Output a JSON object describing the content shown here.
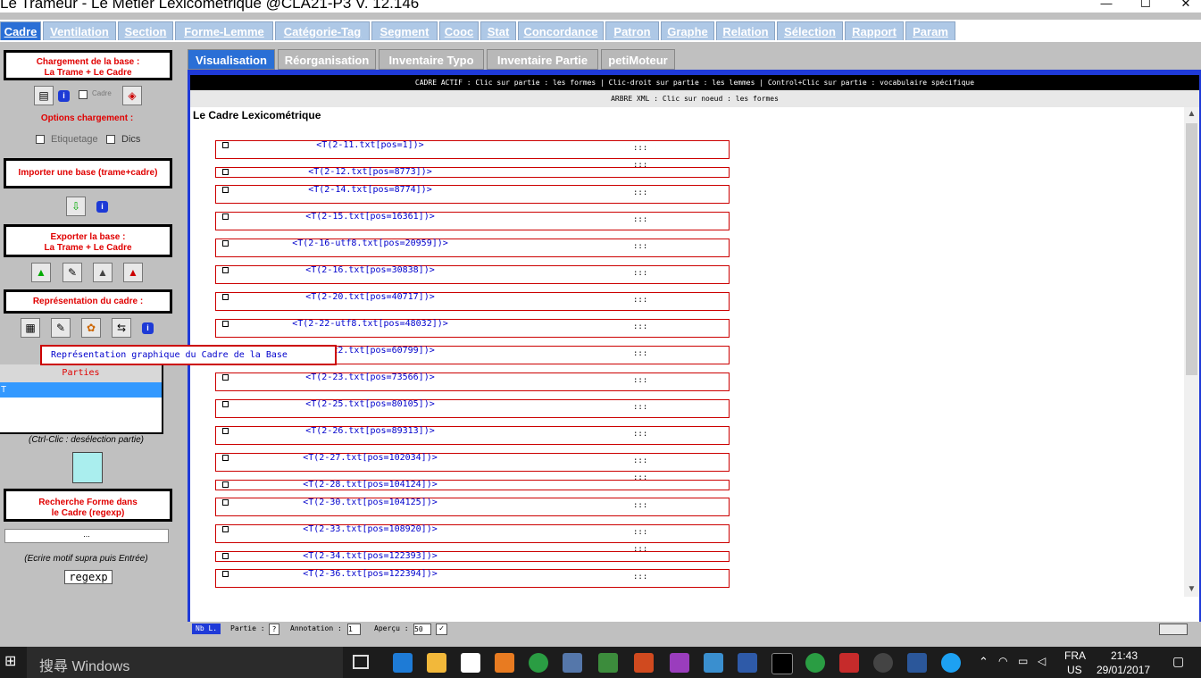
{
  "window": {
    "title": "Le Trameur - Le Métier Lexicométrique @CLA21-P3 V. 12.146",
    "min": "—",
    "max": "☐",
    "close": "✕"
  },
  "main_tabs": [
    "Cadre",
    "Ventilation",
    "Section",
    "Forme-Lemme",
    "Catégorie-Tag",
    "Segment",
    "Cooc",
    "Stat",
    "Concordance",
    "Patron",
    "Graphe",
    "Relation",
    "Sélection",
    "Rapport",
    "Param"
  ],
  "left": {
    "load_box": "Chargement de la base :\nLa Trame + Le Cadre",
    "cadre_label": "Cadre",
    "options_label": "Options chargement :",
    "etiquetage_label": "Etiquetage",
    "dics_label": "Dics",
    "import_box": "Importer une base (trame+cadre)",
    "export_box": "Exporter la base :\nLa Trame + Le Cadre",
    "repr_box": "Représentation du cadre :",
    "parties_header": "Parties",
    "parties_selected": "T",
    "deselect_hint": "(Ctrl-Clic : desélection partie)",
    "search_box": "Recherche Forme dans\nle Cadre (regexp)",
    "search_value": "...",
    "search_hint": "(Ecrire motif supra puis Entrée)",
    "regexp_button": "regexp",
    "info": "i"
  },
  "sub_tabs": [
    "Visualisation",
    "Réorganisation",
    "Inventaire Typo",
    "Inventaire Partie",
    "petiMoteur"
  ],
  "active_bar": "CADRE ACTIF : Clic sur partie : les formes | Clic-droit sur partie : les lemmes | Control+Clic sur partie : vocabulaire spécifique",
  "xml_bar": "ARBRE XML : Clic sur noeud : les formes",
  "content_title": "Le Cadre Lexicométrique",
  "nodes": [
    {
      "label": "<T(2-11.txt[pos=1])>",
      "dots": ":::"
    },
    {
      "label": "<T(2-12.txt[pos=8773])>",
      "dots": ":::"
    },
    {
      "label": "<T(2-14.txt[pos=8774])>",
      "dots": ":::"
    },
    {
      "label": "<T(2-15.txt[pos=16361])>",
      "dots": ":::"
    },
    {
      "label": "<T(2-16-utf8.txt[pos=20959])>",
      "dots": ":::"
    },
    {
      "label": "<T(2-16.txt[pos=30838])>",
      "dots": ":::"
    },
    {
      "label": "<T(2-20.txt[pos=40717])>",
      "dots": ":::"
    },
    {
      "label": "<T(2-22-utf8.txt[pos=48032])>",
      "dots": ":::"
    },
    {
      "label": "<T(2-22.txt[pos=60799])>",
      "dots": ":::"
    },
    {
      "label": "<T(2-23.txt[pos=73566])>",
      "dots": ":::"
    },
    {
      "label": "<T(2-25.txt[pos=80105])>",
      "dots": ":::"
    },
    {
      "label": "<T(2-26.txt[pos=89313])>",
      "dots": ":::"
    },
    {
      "label": "<T(2-27.txt[pos=102034])>",
      "dots": ":::"
    },
    {
      "label": "<T(2-28.txt[pos=104124])>",
      "dots": ":::"
    },
    {
      "label": "<T(2-30.txt[pos=104125])>",
      "dots": ":::"
    },
    {
      "label": "<T(2-33.txt[pos=108920])>",
      "dots": ":::"
    },
    {
      "label": "<T(2-34.txt[pos=122393])>",
      "dots": ":::"
    },
    {
      "label": "<T(2-36.txt[pos=122394])>",
      "dots": ":::"
    }
  ],
  "tooltip": "Représentation graphique du Cadre de la Base",
  "status": {
    "nbl": "Nb L.",
    "partie_label": "Partie :",
    "partie_value": "?",
    "annotation_label": "Annotation :",
    "annotation_value": "1",
    "apercu_label": "Aperçu :",
    "apercu_value": "50"
  },
  "taskbar": {
    "search_placeholder": "搜尋 Windows",
    "lang": "FRA",
    "region": "US",
    "time": "21:43",
    "date": "29/01/2017"
  },
  "colors": {
    "accent": "#2a6fd6",
    "node_border": "#cc0000",
    "node_text": "#0000cc",
    "red_label": "#e00000"
  }
}
